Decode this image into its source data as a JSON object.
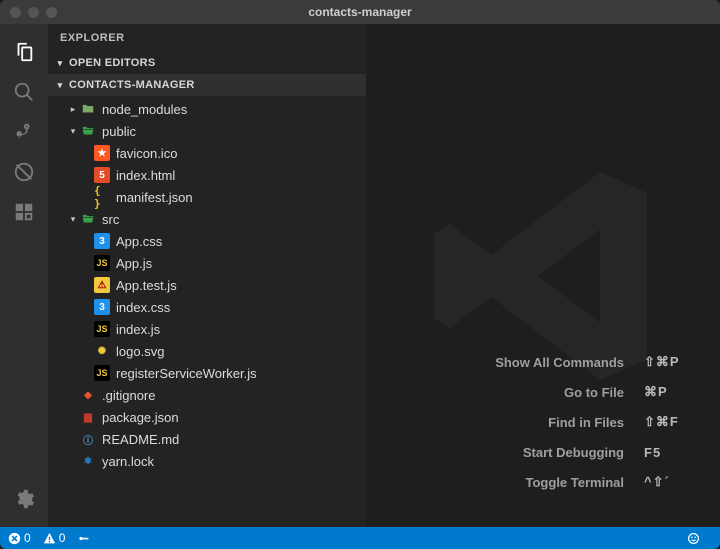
{
  "window": {
    "title": "contacts-manager"
  },
  "explorer": {
    "title": "EXPLORER",
    "openEditors": "OPEN EDITORS",
    "project": "CONTACTS-MANAGER"
  },
  "tree": {
    "node_modules": "node_modules",
    "public": "public",
    "favicon": "favicon.ico",
    "indexhtml": "index.html",
    "manifest": "manifest.json",
    "src": "src",
    "appcss": "App.css",
    "appjs": "App.js",
    "apptest": "App.test.js",
    "indexcss": "index.css",
    "indexjs": "index.js",
    "logosvg": "logo.svg",
    "rsw": "registerServiceWorker.js",
    "gitignore": ".gitignore",
    "package": "package.json",
    "readme": "README.md",
    "yarn": "yarn.lock"
  },
  "welcome": {
    "r1": {
      "label": "Show All Commands",
      "shortcut": "⇧⌘P"
    },
    "r2": {
      "label": "Go to File",
      "shortcut": "⌘P"
    },
    "r3": {
      "label": "Find in Files",
      "shortcut": "⇧⌘F"
    },
    "r4": {
      "label": "Start Debugging",
      "shortcut": "F5"
    },
    "r5": {
      "label": "Toggle Terminal",
      "shortcut": "^⇧´"
    }
  },
  "statusbar": {
    "errors": "0",
    "warnings": "0"
  }
}
